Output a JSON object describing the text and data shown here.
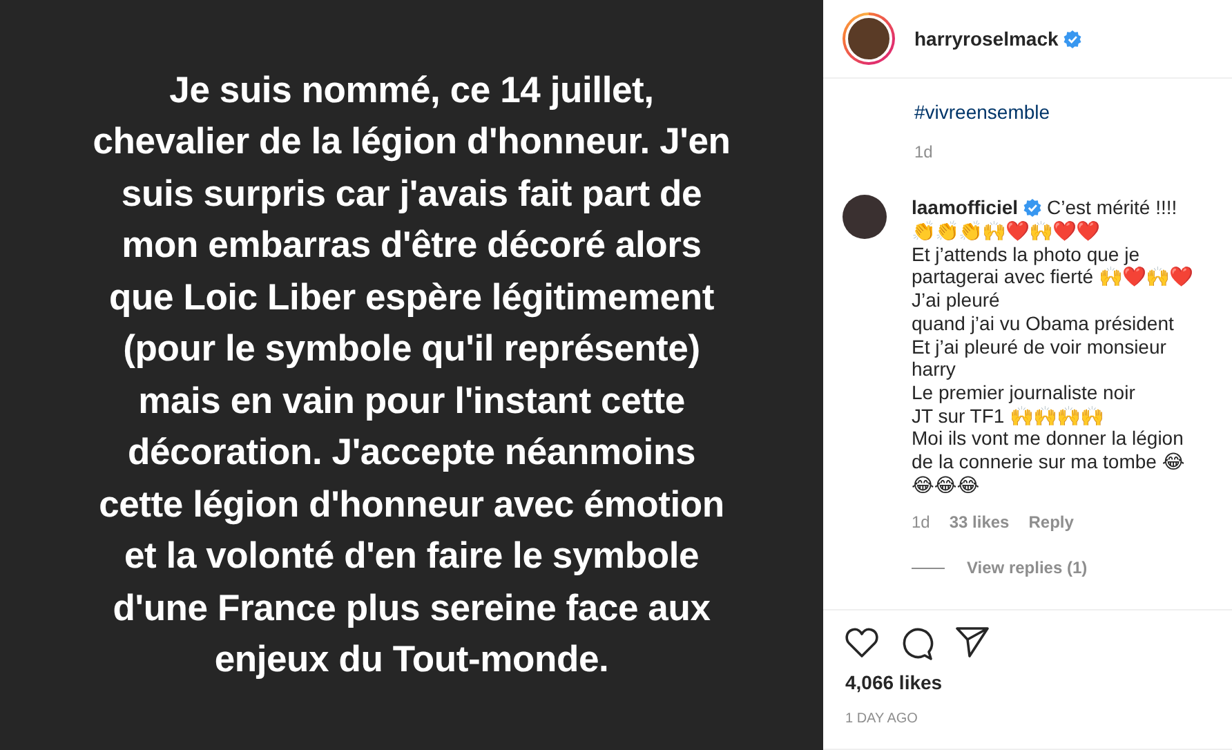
{
  "post_image": {
    "text": "Je suis nommé, ce 14 juillet,\nchevalier de la légion d'honneur. J'en\nsuis surpris car j'avais fait part de\nmon embarras d'être décoré alors\nque Loic Liber espère légitimement\n(pour le symbole qu'il représente)\nmais en vain pour l'instant cette\ndécoration. J'accepte néanmoins\ncette légion d'honneur avec émotion\net la volonté d'en faire le symbole\nd'une France plus sereine face aux\nenjeux du Tout-monde."
  },
  "header": {
    "username": "harryroselmack",
    "verified": true
  },
  "caption": {
    "hashtags": [
      "#vivreensemble"
    ],
    "time": "1d"
  },
  "comments": [
    {
      "username": "laamofficiel",
      "verified": true,
      "text": "C’est mérité !!!!\n👏👏👏🙌❤️🙌❤️❤️\nEt j’attends la photo que je partagerai avec fierté 🙌❤️🙌❤️\nJ’ai pleuré\nquand j’ai vu Obama président\nEt j’ai pleuré de voir monsieur harry\nLe premier journaliste noir\nJT sur TF1 🙌🙌🙌🙌\nMoi ils vont me donner la légion de la connerie sur ma tombe 😂😂😂😂",
      "time": "1d",
      "likes": "33 likes",
      "reply": "Reply",
      "view_replies": "View replies (1)"
    }
  ],
  "actions": {
    "liked": false
  },
  "likes": "4,066 likes",
  "date": "1 DAY AGO"
}
